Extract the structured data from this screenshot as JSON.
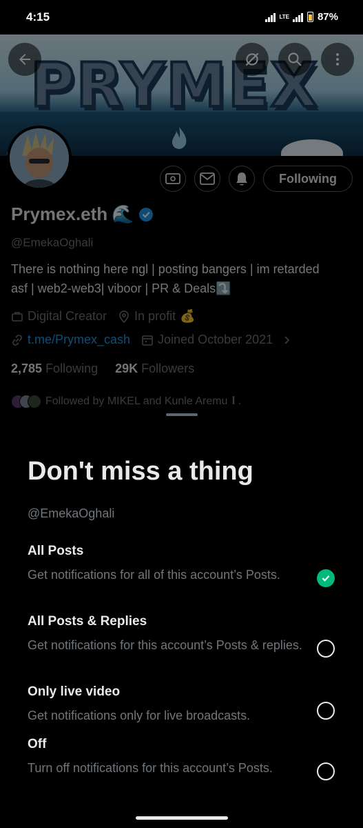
{
  "status_bar": {
    "time": "4:15",
    "network": "LTE",
    "battery": "87%"
  },
  "banner": {
    "title": "PRYMEX"
  },
  "profile": {
    "following_label": "Following",
    "name": "Prymex.eth",
    "name_emoji": "🌊",
    "handle": "@EmekaOghali",
    "bio": "There is nothing here ngl | posting bangers | im retarded asf | web2-web3| viboor | PR & Deals⤵️",
    "category": "Digital Creator",
    "location": "In profit",
    "location_emoji": "💰",
    "website": "t.me/Prymex_cash",
    "joined": "Joined October 2021",
    "following_count": "2,785",
    "following_word": "Following",
    "followers_count": "29K",
    "followers_word": "Followers",
    "followed_by": "Followed by MIKEL and Kunle Aremu",
    "followed_by_suffix": "𝐈 ."
  },
  "sheet": {
    "title": "Don't miss a thing",
    "handle": "@EmekaOghali",
    "options": [
      {
        "title": "All Posts",
        "desc": "Get notifications for all of this account’s Posts.",
        "selected": true
      },
      {
        "title": "All Posts & Replies",
        "desc": "Get notifications for this account’s Posts & replies.",
        "selected": false
      },
      {
        "title": "Only live video",
        "desc": "Get notifications only for live broadcasts.",
        "selected": false
      },
      {
        "title": "Off",
        "desc": "Turn off notifications for this account’s Posts.",
        "selected": false
      }
    ]
  },
  "colors": {
    "accent_blue": "#1d9bf0",
    "selected_green": "#00ba7c",
    "secondary_text": "#71767b"
  },
  "icons": [
    "back-arrow-icon",
    "no-retweet-icon",
    "search-icon",
    "more-vertical-icon",
    "subscribe-icon",
    "message-icon",
    "bell-icon",
    "verified-badge-icon",
    "briefcase-icon",
    "location-icon",
    "link-icon",
    "calendar-icon",
    "chevron-right-icon",
    "checkmark-icon"
  ]
}
